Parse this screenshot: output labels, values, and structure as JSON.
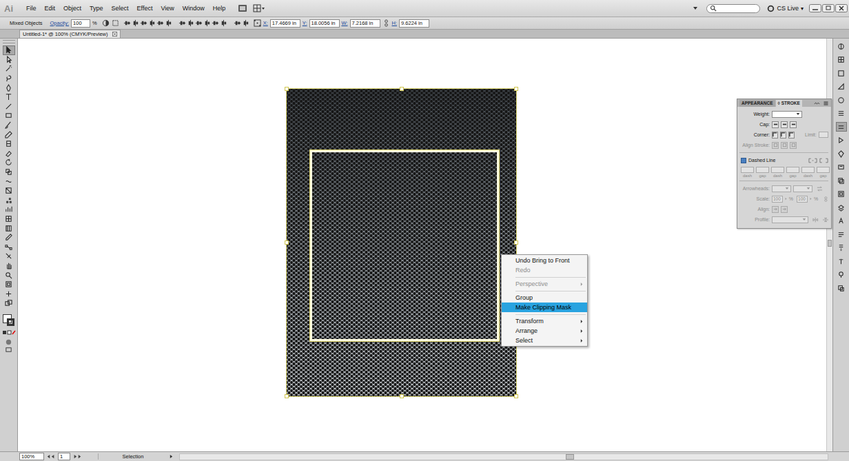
{
  "app": {
    "logo": "Ai"
  },
  "menu": [
    "File",
    "Edit",
    "Object",
    "Type",
    "Select",
    "Effect",
    "View",
    "Window",
    "Help"
  ],
  "cs_live": {
    "label": "CS Live",
    "caret": "▾"
  },
  "control_bar": {
    "selection": "Mixed Objects",
    "opacity_label": "Opacity:",
    "opacity": "100",
    "opacity_unit": "%",
    "fields": [
      {
        "label": "X:",
        "value": "17.4669 in"
      },
      {
        "label": "Y:",
        "value": "18.0056 in"
      },
      {
        "label": "W:",
        "value": "7.2168 in"
      },
      {
        "label": "H:",
        "value": "9.6224 in"
      }
    ]
  },
  "document_tab": {
    "title": "Untitled-1* @ 100% (CMYK/Preview)"
  },
  "tools": [
    {
      "selected": true
    },
    {
      "selected": false
    },
    {
      "selected": false
    },
    {
      "selected": false
    },
    {
      "selected": false
    },
    {
      "selected": false
    },
    {
      "selected": false
    },
    {
      "selected": false
    },
    {
      "selected": false
    },
    {
      "selected": false
    },
    {
      "selected": false
    },
    {
      "selected": false
    },
    {
      "selected": false
    },
    {
      "selected": false
    },
    {
      "selected": false
    },
    {
      "selected": false
    },
    {
      "selected": false
    },
    {
      "selected": false
    },
    {
      "selected": false
    },
    {
      "selected": false
    },
    {
      "selected": false
    },
    {
      "selected": false
    },
    {
      "selected": false
    },
    {
      "selected": false
    },
    {
      "selected": false
    },
    {
      "selected": false
    },
    {
      "selected": false
    },
    {
      "selected": false
    }
  ],
  "dock": [
    {
      "selected": false
    },
    {
      "selected": false
    },
    {
      "selected": false
    },
    {
      "selected": false
    },
    {
      "selected": false
    },
    {
      "selected": false
    },
    {
      "selected": true
    },
    {
      "selected": false
    },
    {
      "selected": false
    },
    {
      "selected": false
    },
    {
      "selected": false
    },
    {
      "selected": false
    },
    {
      "selected": false
    },
    {
      "selected": false
    },
    {
      "selected": false
    },
    {
      "selected": false
    },
    {
      "selected": false
    },
    {
      "selected": false
    },
    {
      "selected": false
    }
  ],
  "context_menu": {
    "items": [
      {
        "kind": "item",
        "label": "Undo Bring to Front",
        "disabled": false,
        "selected": false,
        "submenu": false
      },
      {
        "kind": "item",
        "label": "Redo",
        "disabled": true,
        "selected": false,
        "submenu": false
      },
      {
        "kind": "separator"
      },
      {
        "kind": "item",
        "label": "Perspective",
        "disabled": true,
        "selected": false,
        "submenu": true
      },
      {
        "kind": "separator"
      },
      {
        "kind": "item",
        "label": "Group",
        "disabled": false,
        "selected": false,
        "submenu": false
      },
      {
        "kind": "item",
        "label": "Make Clipping Mask",
        "disabled": false,
        "selected": true,
        "submenu": false
      },
      {
        "kind": "separator"
      },
      {
        "kind": "item",
        "label": "Transform",
        "disabled": false,
        "selected": false,
        "submenu": true
      },
      {
        "kind": "item",
        "label": "Arrange",
        "disabled": false,
        "selected": false,
        "submenu": true
      },
      {
        "kind": "item",
        "label": "Select",
        "disabled": false,
        "selected": false,
        "submenu": true
      }
    ]
  },
  "stroke_panel": {
    "tabs": [
      {
        "label": "APPEARANCE",
        "icon": "",
        "selected": false
      },
      {
        "label": "STROKE",
        "icon": "◊",
        "selected": true
      }
    ],
    "weight": {
      "label": "Weight:",
      "disabled": false
    },
    "cap": {
      "label": "Cap:",
      "disabled": false
    },
    "corner": {
      "label": "Corner:",
      "disabled": false
    },
    "limit": {
      "label": "Limit:",
      "disabled": true
    },
    "align_stroke": {
      "label": "Align Stroke:",
      "disabled": true
    },
    "dashed_line": {
      "label": "Dashed Line",
      "checked": false,
      "mixed": true
    },
    "dash_gap": [
      {
        "label": "dash",
        "disabled": true
      },
      {
        "label": "gap",
        "disabled": true
      },
      {
        "label": "dash",
        "disabled": true
      },
      {
        "label": "gap",
        "disabled": true
      },
      {
        "label": "dash",
        "disabled": true
      },
      {
        "label": "gap",
        "disabled": true
      }
    ],
    "arrowheads": {
      "label": "Arrowheads:",
      "disabled": true
    },
    "scale": {
      "label": "Scale:",
      "values": [
        "100",
        "100"
      ],
      "unit": "%",
      "disabled": true
    },
    "align": {
      "label": "Align:",
      "disabled": true
    },
    "profile": {
      "label": "Profile:",
      "disabled": true
    }
  },
  "status_bar": {
    "zoom": "100%",
    "page": "1",
    "tool": "Selection"
  }
}
